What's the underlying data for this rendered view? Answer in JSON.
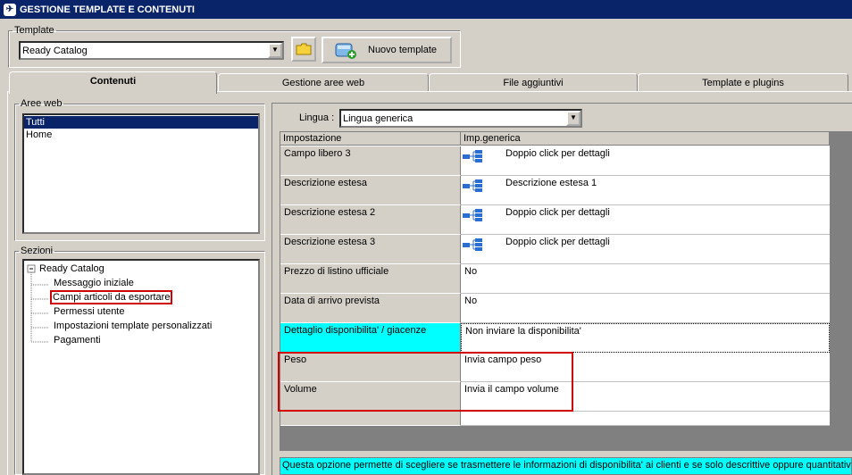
{
  "window": {
    "title": "GESTIONE TEMPLATE E CONTENUTI",
    "icon": "app-logo-icon"
  },
  "template": {
    "legend": "Template",
    "selected": "Ready Catalog",
    "new_button": "Nuovo template"
  },
  "tabs": [
    {
      "label": "Contenuti",
      "active": true
    },
    {
      "label": "Gestione aree web"
    },
    {
      "label": "File aggiuntivi"
    },
    {
      "label": "Template e plugins"
    }
  ],
  "aree_web": {
    "legend": "Aree web",
    "items": [
      "Tutti",
      "Home"
    ]
  },
  "sezioni": {
    "legend": "Sezioni",
    "root": "Ready Catalog",
    "children": [
      "Messaggio iniziale",
      "Campi articoli da esportare",
      "Permessi utente",
      "Impostazioni template personalizzati",
      "Pagamenti"
    ]
  },
  "lingua": {
    "label": "Lingua :",
    "selected": "Lingua generica"
  },
  "grid": {
    "headers": [
      "Impostazione",
      "Imp.generica"
    ],
    "rows": [
      {
        "name": "Campo libero 3",
        "value": "Doppio click per dettagli",
        "has_icon": true
      },
      {
        "name": "Descrizione estesa",
        "value": "Descrizione estesa 1",
        "has_icon": true
      },
      {
        "name": "Descrizione estesa 2",
        "value": "Doppio click per dettagli",
        "has_icon": true
      },
      {
        "name": "Descrizione estesa 3",
        "value": "Doppio click per dettagli",
        "has_icon": true
      },
      {
        "name": "Prezzo di listino ufficiale",
        "value": "No",
        "has_icon": false
      },
      {
        "name": "Data di arrivo prevista",
        "value": "No",
        "has_icon": false
      },
      {
        "name": "Dettaglio disponibilita' / giacenze",
        "value": "Non inviare la disponibilita'",
        "has_icon": false,
        "selected": true
      },
      {
        "name": "Peso",
        "value": "Invia campo peso",
        "has_icon": false
      },
      {
        "name": "Volume",
        "value": "Invia il campo volume",
        "has_icon": false
      }
    ]
  },
  "help_text": "Questa opzione permette di scegliere se trasmettere le informazioni di disponibilita' ai clienti e se solo descrittive oppure quantitative",
  "colors": {
    "titlebar": "#0a246a",
    "selection": "#0a246a",
    "highlight_cell": "#00ffff",
    "annotation": "#d00000"
  }
}
